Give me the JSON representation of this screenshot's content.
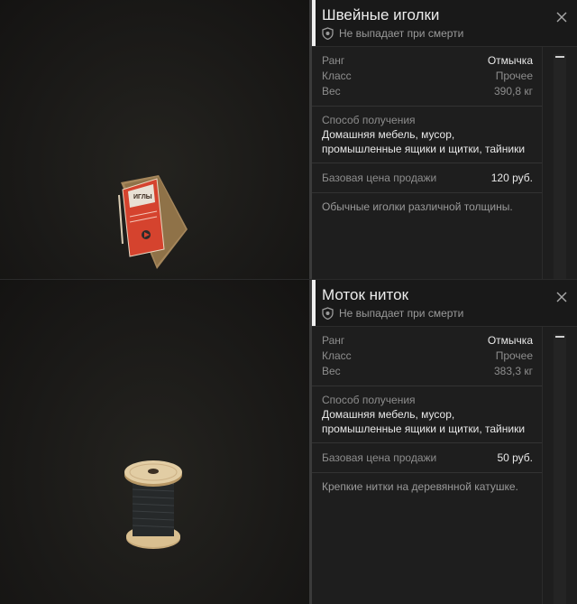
{
  "items": [
    {
      "title": "Швейные иголки",
      "drop_note": "Не выпадает при смерти",
      "stats": [
        {
          "label": "Ранг",
          "value": "Отмычка"
        },
        {
          "label": "Класс",
          "value": "Прочее"
        },
        {
          "label": "Вес",
          "value": "390,8 кг"
        }
      ],
      "source_label": "Способ получения",
      "source_value": "Домашняя мебель, мусор, промышленные ящики и щитки, тайники",
      "price_label": "Базовая цена продажи",
      "price_value": "120 руб.",
      "description": "Обычные иголки различной толщины.",
      "icon": "needles-package"
    },
    {
      "title": "Моток ниток",
      "drop_note": "Не выпадает при смерти",
      "stats": [
        {
          "label": "Ранг",
          "value": "Отмычка"
        },
        {
          "label": "Класс",
          "value": "Прочее"
        },
        {
          "label": "Вес",
          "value": "383,3 кг"
        }
      ],
      "source_label": "Способ получения",
      "source_value": "Домашняя мебель, мусор, промышленные ящики и щитки, тайники",
      "price_label": "Базовая цена продажи",
      "price_value": "50 руб.",
      "description": "Крепкие нитки на деревянной катушке.",
      "icon": "thread-spool"
    }
  ],
  "package_text": "ИГЛЫ"
}
